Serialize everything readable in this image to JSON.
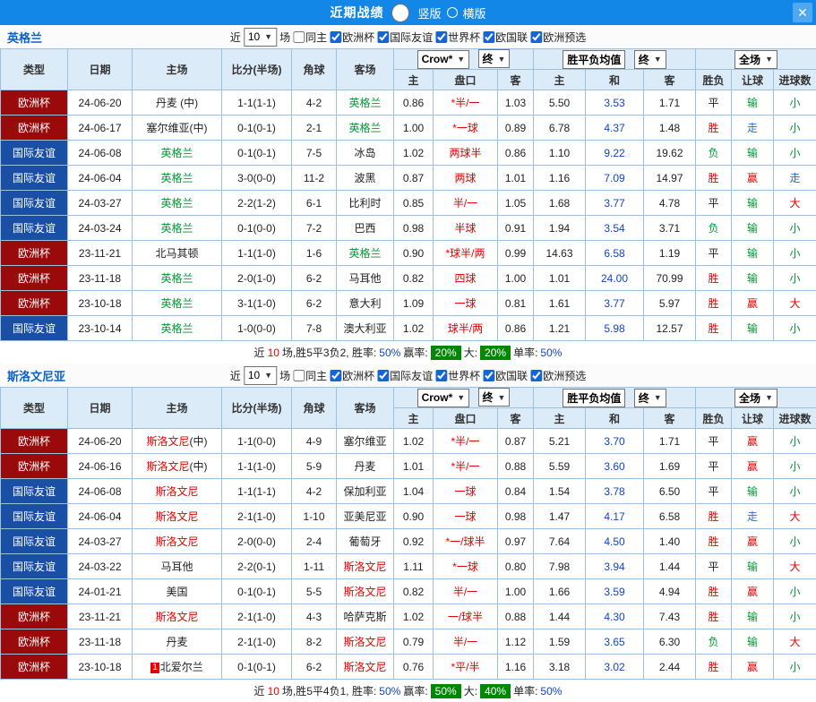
{
  "icons": {
    "close": "✕",
    "dropdown_arrow": "▼"
  },
  "colors": {
    "titlebar_bg": "#1287e7",
    "header_bg": "#dcebf8",
    "grid_border": "#9fc0dc",
    "badge_bg": "#008800",
    "handicap_text": "#e60000",
    "draw_odds_text": "#1144cc"
  },
  "type_colors": {
    "欧洲杯": "#9b0a0a",
    "国际友谊": "#1a4fa6"
  },
  "result_colors": {
    "胜": "#e60000",
    "平": "#222222",
    "负": "#009933",
    "赢": "#e60000",
    "输": "#009933",
    "走": "#2b6bd6",
    "大": "#e60000",
    "小": "#009933"
  },
  "titlebar": {
    "title": "近期战绩",
    "vertical_label": "竖版",
    "horizontal_label": "横版",
    "selected": "竖版"
  },
  "filters": {
    "near_label": "近",
    "count_value": "10",
    "unit_label": "场",
    "checkboxes": [
      {
        "label": "同主",
        "checked": false
      },
      {
        "label": "欧洲杯",
        "checked": true
      },
      {
        "label": "国际友谊",
        "checked": true
      },
      {
        "label": "世界杯",
        "checked": true
      },
      {
        "label": "欧国联",
        "checked": true
      },
      {
        "label": "欧洲预选",
        "checked": true
      }
    ]
  },
  "table_headers": {
    "type_col": "类型",
    "date_col": "日期",
    "home_col": "主场",
    "score_col": "比分(半场)",
    "corner_col": "角球",
    "away_col": "客场",
    "company_select": "Crow*",
    "final_select": "终",
    "wdl_select": "胜平负均值",
    "final_select2": "终",
    "scope_select": "全场",
    "sub_home": "主",
    "sub_handicap": "盘口",
    "sub_away": "客",
    "sub_win": "主",
    "sub_draw": "和",
    "sub_lose": "客",
    "sub_result": "胜负",
    "sub_let": "让球",
    "sub_goal": "进球数"
  },
  "sections": [
    {
      "team": "英格兰",
      "team_color": "#009933",
      "rows": [
        {
          "type": "欧洲杯",
          "date": "24-06-20",
          "home": "丹麦",
          "home_suffix": " (中)",
          "home_hl": false,
          "score": "1-1(1-1)",
          "corners": "4-2",
          "away": "英格兰",
          "away_hl": true,
          "odds_home": "0.86",
          "handicap": "*半/一",
          "odds_away": "1.03",
          "win": "5.50",
          "draw": "3.53",
          "lose": "1.71",
          "result": "平",
          "handicap_result": "输",
          "goals": "小"
        },
        {
          "type": "欧洲杯",
          "date": "24-06-17",
          "home": "塞尔维亚",
          "home_suffix": "(中)",
          "home_hl": false,
          "score": "0-1(0-1)",
          "corners": "2-1",
          "away": "英格兰",
          "away_hl": true,
          "odds_home": "1.00",
          "handicap": "*一球",
          "odds_away": "0.89",
          "win": "6.78",
          "draw": "4.37",
          "lose": "1.48",
          "result": "胜",
          "handicap_result": "走",
          "goals": "小"
        },
        {
          "type": "国际友谊",
          "date": "24-06-08",
          "home": "英格兰",
          "home_hl": true,
          "score": "0-1(0-1)",
          "corners": "7-5",
          "away": "冰岛",
          "away_hl": false,
          "odds_home": "1.02",
          "handicap": "两球半",
          "odds_away": "0.86",
          "win": "1.10",
          "draw": "9.22",
          "lose": "19.62",
          "result": "负",
          "handicap_result": "输",
          "goals": "小"
        },
        {
          "type": "国际友谊",
          "date": "24-06-04",
          "home": "英格兰",
          "home_hl": true,
          "score": "3-0(0-0)",
          "corners": "11-2",
          "away": "波黑",
          "away_hl": false,
          "odds_home": "0.87",
          "handicap": "两球",
          "odds_away": "1.01",
          "win": "1.16",
          "draw": "7.09",
          "lose": "14.97",
          "result": "胜",
          "handicap_result": "赢",
          "goals": "走"
        },
        {
          "type": "国际友谊",
          "date": "24-03-27",
          "home": "英格兰",
          "home_hl": true,
          "score": "2-2(1-2)",
          "corners": "6-1",
          "away": "比利时",
          "away_hl": false,
          "odds_home": "0.85",
          "handicap": "半/一",
          "odds_away": "1.05",
          "win": "1.68",
          "draw": "3.77",
          "lose": "4.78",
          "result": "平",
          "handicap_result": "输",
          "goals": "大"
        },
        {
          "type": "国际友谊",
          "date": "24-03-24",
          "home": "英格兰",
          "home_hl": true,
          "score": "0-1(0-0)",
          "corners": "7-2",
          "away": "巴西",
          "away_hl": false,
          "odds_home": "0.98",
          "handicap": "半球",
          "odds_away": "0.91",
          "win": "1.94",
          "draw": "3.54",
          "lose": "3.71",
          "result": "负",
          "handicap_result": "输",
          "goals": "小"
        },
        {
          "type": "欧洲杯",
          "date": "23-11-21",
          "home": "北马其顿",
          "home_hl": false,
          "score": "1-1(1-0)",
          "corners": "1-6",
          "away": "英格兰",
          "away_hl": true,
          "odds_home": "0.90",
          "handicap": "*球半/两",
          "odds_away": "0.99",
          "win": "14.63",
          "draw": "6.58",
          "lose": "1.19",
          "result": "平",
          "handicap_result": "输",
          "goals": "小"
        },
        {
          "type": "欧洲杯",
          "date": "23-11-18",
          "home": "英格兰",
          "home_hl": true,
          "score": "2-0(1-0)",
          "corners": "6-2",
          "away": "马耳他",
          "away_hl": false,
          "odds_home": "0.82",
          "handicap": "四球",
          "odds_away": "1.00",
          "win": "1.01",
          "draw": "24.00",
          "lose": "70.99",
          "result": "胜",
          "handicap_result": "输",
          "goals": "小"
        },
        {
          "type": "欧洲杯",
          "date": "23-10-18",
          "home": "英格兰",
          "home_hl": true,
          "score": "3-1(1-0)",
          "corners": "6-2",
          "away": "意大利",
          "away_hl": false,
          "odds_home": "1.09",
          "handicap": "一球",
          "odds_away": "0.81",
          "win": "1.61",
          "draw": "3.77",
          "lose": "5.97",
          "result": "胜",
          "handicap_result": "赢",
          "goals": "大"
        },
        {
          "type": "国际友谊",
          "date": "23-10-14",
          "home": "英格兰",
          "home_hl": true,
          "score": "1-0(0-0)",
          "corners": "7-8",
          "away": "澳大利亚",
          "away_hl": false,
          "odds_home": "1.02",
          "handicap": "球半/两",
          "odds_away": "0.86",
          "win": "1.21",
          "draw": "5.98",
          "lose": "12.57",
          "result": "胜",
          "handicap_result": "输",
          "goals": "小"
        }
      ],
      "summary": [
        {
          "text": "近"
        },
        {
          "text": "10",
          "color": "#e60000"
        },
        {
          "text": "场,胜5平3负2, 胜率:"
        },
        {
          "text": "50%",
          "color": "#1144cc"
        },
        {
          "text": " 赢率: "
        },
        {
          "text": "20%",
          "badge": true
        },
        {
          "text": " 大: "
        },
        {
          "text": "20%",
          "badge": true
        },
        {
          "text": " 单率:"
        },
        {
          "text": "50%",
          "color": "#1144cc"
        }
      ]
    },
    {
      "team": "斯洛文尼亚",
      "team_color": "#e60000",
      "rows": [
        {
          "type": "欧洲杯",
          "date": "24-06-20",
          "home": "斯洛文尼",
          "home_suffix": "(中)",
          "home_hl": true,
          "score": "1-1(0-0)",
          "corners": "4-9",
          "away": "塞尔维亚",
          "away_hl": false,
          "odds_home": "1.02",
          "handicap": "*半/一",
          "odds_away": "0.87",
          "win": "5.21",
          "draw": "3.70",
          "lose": "1.71",
          "result": "平",
          "handicap_result": "赢",
          "goals": "小"
        },
        {
          "type": "欧洲杯",
          "date": "24-06-16",
          "home": "斯洛文尼",
          "home_suffix": "(中)",
          "home_hl": true,
          "score": "1-1(1-0)",
          "corners": "5-9",
          "away": "丹麦",
          "away_hl": false,
          "odds_home": "1.01",
          "handicap": "*半/一",
          "odds_away": "0.88",
          "win": "5.59",
          "draw": "3.60",
          "lose": "1.69",
          "result": "平",
          "handicap_result": "赢",
          "goals": "小"
        },
        {
          "type": "国际友谊",
          "date": "24-06-08",
          "home": "斯洛文尼",
          "home_hl": true,
          "score": "1-1(1-1)",
          "corners": "4-2",
          "away": "保加利亚",
          "away_hl": false,
          "odds_home": "1.04",
          "handicap": "一球",
          "odds_away": "0.84",
          "win": "1.54",
          "draw": "3.78",
          "lose": "6.50",
          "result": "平",
          "handicap_result": "输",
          "goals": "小"
        },
        {
          "type": "国际友谊",
          "date": "24-06-04",
          "home": "斯洛文尼",
          "home_hl": true,
          "score": "2-1(1-0)",
          "corners": "1-10",
          "away": "亚美尼亚",
          "away_hl": false,
          "odds_home": "0.90",
          "handicap": "一球",
          "odds_away": "0.98",
          "win": "1.47",
          "draw": "4.17",
          "lose": "6.58",
          "result": "胜",
          "handicap_result": "走",
          "goals": "大"
        },
        {
          "type": "国际友谊",
          "date": "24-03-27",
          "home": "斯洛文尼",
          "home_hl": true,
          "score": "2-0(0-0)",
          "corners": "2-4",
          "away": "葡萄牙",
          "away_hl": false,
          "odds_home": "0.92",
          "handicap": "*一/球半",
          "odds_away": "0.97",
          "win": "7.64",
          "draw": "4.50",
          "lose": "1.40",
          "result": "胜",
          "handicap_result": "赢",
          "goals": "小"
        },
        {
          "type": "国际友谊",
          "date": "24-03-22",
          "home": "马耳他",
          "home_hl": false,
          "score": "2-2(0-1)",
          "corners": "1-11",
          "away": "斯洛文尼",
          "away_hl": true,
          "odds_home": "1.11",
          "handicap": "*一球",
          "odds_away": "0.80",
          "win": "7.98",
          "draw": "3.94",
          "lose": "1.44",
          "result": "平",
          "handicap_result": "输",
          "goals": "大"
        },
        {
          "type": "国际友谊",
          "date": "24-01-21",
          "home": "美国",
          "home_hl": false,
          "score": "0-1(0-1)",
          "corners": "5-5",
          "away": "斯洛文尼",
          "away_hl": true,
          "odds_home": "0.82",
          "handicap": "半/一",
          "odds_away": "1.00",
          "win": "1.66",
          "draw": "3.59",
          "lose": "4.94",
          "result": "胜",
          "handicap_result": "赢",
          "goals": "小"
        },
        {
          "type": "欧洲杯",
          "date": "23-11-21",
          "home": "斯洛文尼",
          "home_hl": true,
          "score": "2-1(1-0)",
          "corners": "4-3",
          "away": "哈萨克斯",
          "away_hl": false,
          "odds_home": "1.02",
          "handicap": "一/球半",
          "odds_away": "0.88",
          "win": "1.44",
          "draw": "4.30",
          "lose": "7.43",
          "result": "胜",
          "handicap_result": "输",
          "goals": "小"
        },
        {
          "type": "欧洲杯",
          "date": "23-11-18",
          "home": "丹麦",
          "home_hl": false,
          "score": "2-1(1-0)",
          "corners": "8-2",
          "away": "斯洛文尼",
          "away_hl": true,
          "odds_home": "0.79",
          "handicap": "半/一",
          "odds_away": "1.12",
          "win": "1.59",
          "draw": "3.65",
          "lose": "6.30",
          "result": "负",
          "handicap_result": "输",
          "goals": "大"
        },
        {
          "type": "欧洲杯",
          "date": "23-10-18",
          "home": "北爱尔兰",
          "home_badge": "1",
          "home_hl": false,
          "score": "0-1(0-1)",
          "corners": "6-2",
          "away": "斯洛文尼",
          "away_hl": true,
          "odds_home": "0.76",
          "handicap": "*平/半",
          "odds_away": "1.16",
          "win": "3.18",
          "draw": "3.02",
          "lose": "2.44",
          "result": "胜",
          "handicap_result": "赢",
          "goals": "小"
        }
      ],
      "summary": [
        {
          "text": "近"
        },
        {
          "text": "10",
          "color": "#e60000"
        },
        {
          "text": "场,胜5平4负1, 胜率:"
        },
        {
          "text": "50%",
          "color": "#1144cc"
        },
        {
          "text": " 赢率:"
        },
        {
          "text": "50%",
          "badge": true
        },
        {
          "text": " 大:"
        },
        {
          "text": "40%",
          "badge": true
        },
        {
          "text": " 单率:"
        },
        {
          "text": "50%",
          "color": "#1144cc"
        }
      ]
    }
  ]
}
